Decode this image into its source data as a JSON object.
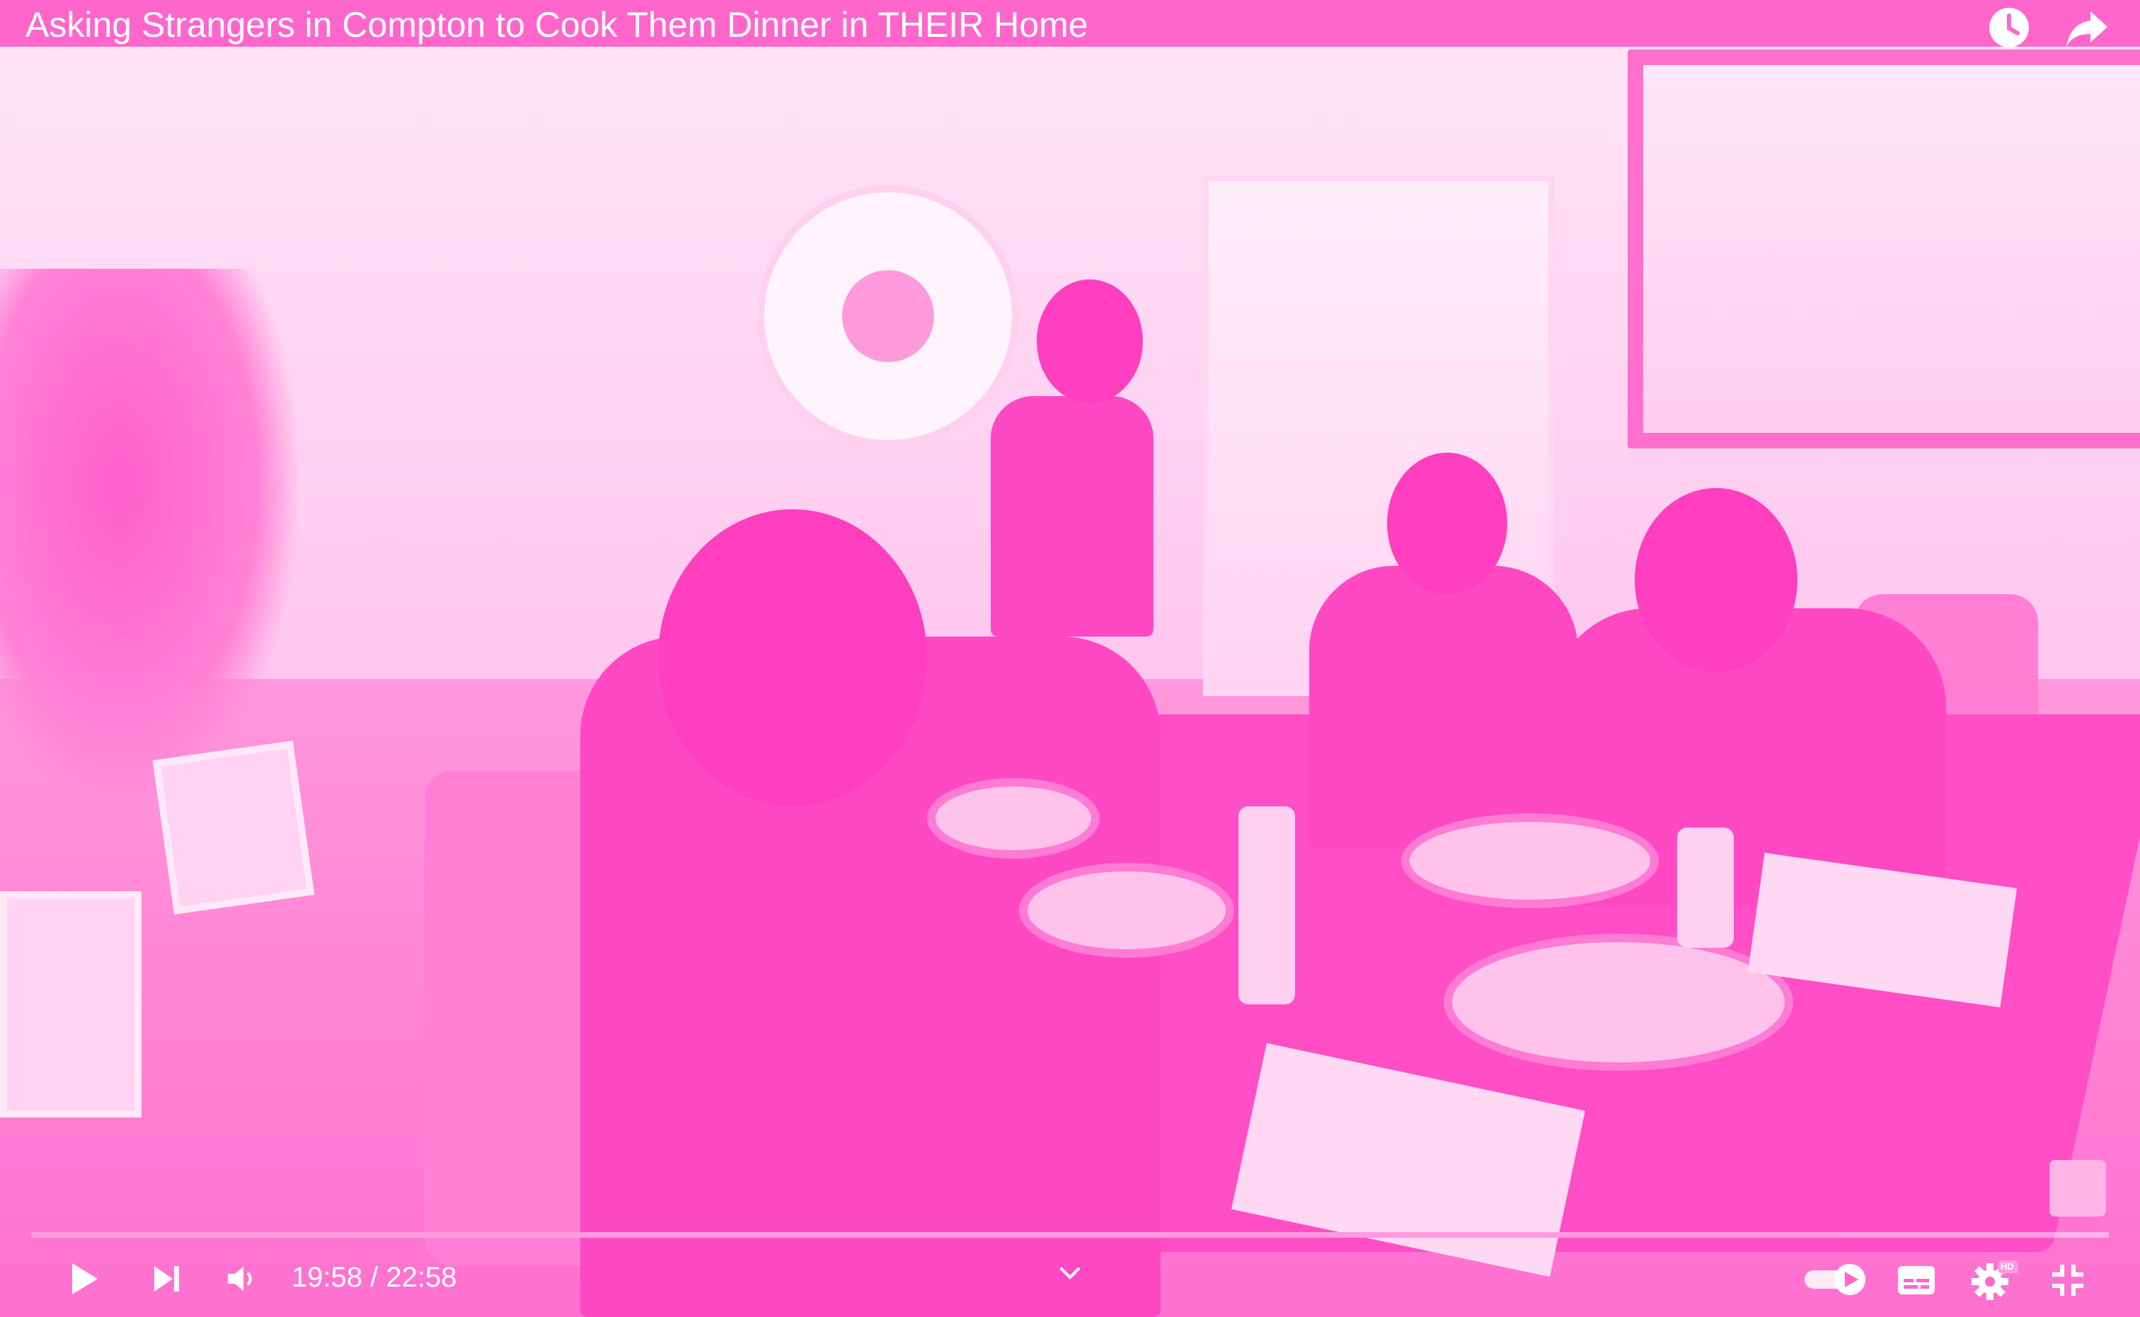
{
  "video": {
    "title": "Asking Strangers in Compton to Cook Them Dinner in THEIR Home",
    "progress": 0.8694,
    "tint": "#ff66cc"
  },
  "player": {
    "current_time": "19:58",
    "separator": " / ",
    "duration": "22:58",
    "autoplay_on": true,
    "hd": "HD"
  },
  "icons": {
    "watch_later": "clock-icon",
    "share": "share-arrow-icon",
    "play": "play-icon",
    "next": "next-icon",
    "volume": "volume-icon",
    "chapters": "chevron-down-icon",
    "autoplay": "autoplay-toggle-icon",
    "captions": "captions-icon",
    "settings": "gear-icon",
    "fullscreen": "exit-fullscreen-icon"
  }
}
